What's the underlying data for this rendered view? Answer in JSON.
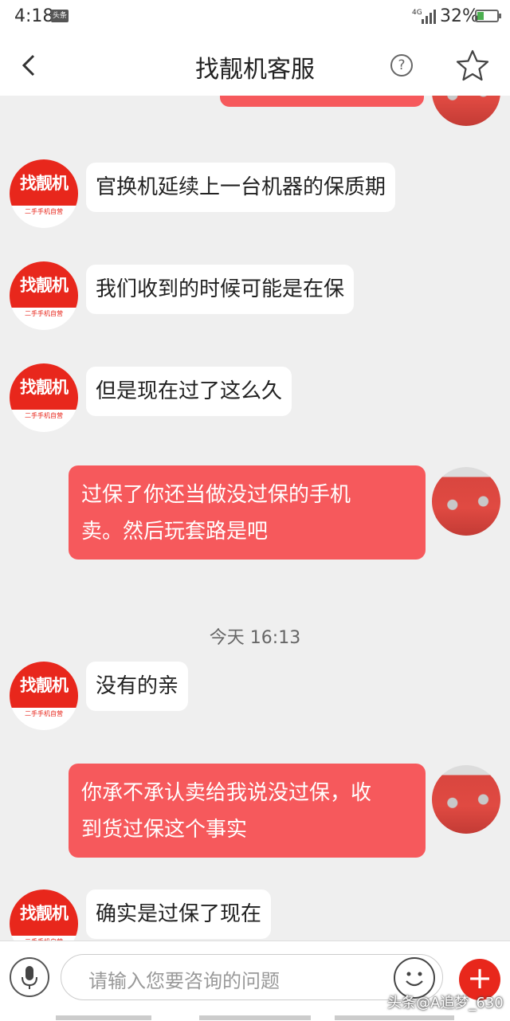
{
  "status_bar": {
    "time": "4:18",
    "app_badge": "头条",
    "network": "4G",
    "battery": "32%",
    "battery_level": 0.32
  },
  "header": {
    "title": "找靓机客服",
    "help_icon": "question-circle-icon",
    "star_icon": "star-outline-icon"
  },
  "shop_avatar": {
    "logo": "找靓机",
    "tagline": "二手手机自营"
  },
  "messages": [
    {
      "from": "shop",
      "text": "官换机延续上一台机器的保质期"
    },
    {
      "from": "shop",
      "text": "我们收到的时候可能是在保"
    },
    {
      "from": "shop",
      "text": "但是现在过了这么久"
    },
    {
      "from": "user",
      "line1": "过保了你还当做没过保的手机",
      "line2": "卖。然后玩套路是吧"
    },
    {
      "from": "shop",
      "text": "没有的亲"
    },
    {
      "from": "user",
      "line1": "你承不承认卖给我说没过保，收",
      "line2": "到货过保这个事实"
    },
    {
      "from": "shop",
      "text": "确实是过保了现在"
    }
  ],
  "timestamp": "今天 16:13",
  "input": {
    "placeholder": "请输入您要咨询的问题"
  },
  "watermark": "头条@A追梦_630",
  "colors": {
    "accent": "#e8271c",
    "user_bubble": "#f6595c",
    "background": "#efefef"
  }
}
